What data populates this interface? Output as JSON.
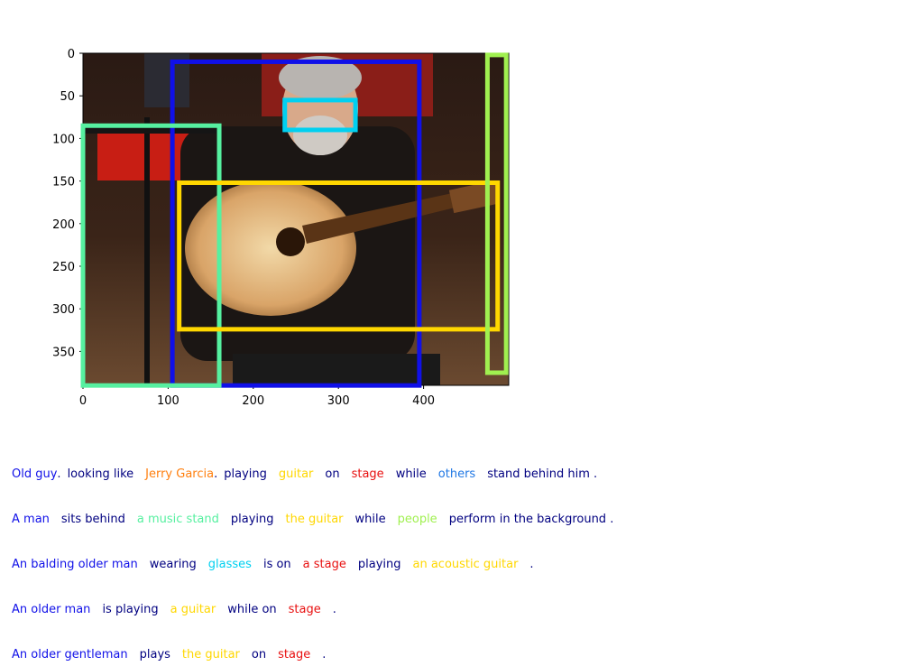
{
  "colors": {
    "blue": "#1010e8",
    "navy": "#000080",
    "orange": "#ff7f0e",
    "yellow": "#ffd700",
    "red": "#e81010",
    "azure": "#1f77e4",
    "mint": "#56f0a0",
    "lime": "#a0f050",
    "cyan": "#00d0f0"
  },
  "axes": {
    "x_ticks": [
      "0",
      "100",
      "200",
      "300",
      "400"
    ],
    "y_ticks": [
      "0",
      "50",
      "100",
      "150",
      "200",
      "250",
      "300",
      "350"
    ],
    "xlim": [
      0,
      500
    ],
    "ylim": [
      390,
      0
    ]
  },
  "boxes": [
    {
      "name": "man",
      "color": "#1010e8",
      "x": [
        105,
        395
      ],
      "y": [
        10,
        390
      ]
    },
    {
      "name": "music-stand",
      "color": "#56f0a0",
      "x": [
        0,
        160
      ],
      "y": [
        85,
        390
      ]
    },
    {
      "name": "guitar",
      "color": "#ffd700",
      "x": [
        113,
        487
      ],
      "y": [
        152,
        324
      ]
    },
    {
      "name": "glasses",
      "color": "#00d0f0",
      "x": [
        237,
        320
      ],
      "y": [
        55,
        90
      ]
    },
    {
      "name": "people",
      "color": "#a0f050",
      "x": [
        475,
        497
      ],
      "y": [
        2,
        375
      ]
    }
  ],
  "captions": [
    [
      {
        "text": "Old guy",
        "color": "#1010e8"
      },
      {
        "text": ".",
        "color": "#000080",
        "punct": true
      },
      {
        "text": "looking like",
        "color": "#000080"
      },
      {
        "text": "Jerry Garcia",
        "color": "#ff7f0e"
      },
      {
        "text": ".",
        "color": "#000080",
        "punct": true
      },
      {
        "text": "playing",
        "color": "#000080"
      },
      {
        "text": "guitar",
        "color": "#ffd700"
      },
      {
        "text": "on",
        "color": "#000080"
      },
      {
        "text": "stage",
        "color": "#e81010"
      },
      {
        "text": "while",
        "color": "#000080"
      },
      {
        "text": "others",
        "color": "#1f77e4"
      },
      {
        "text": "stand behind him .",
        "color": "#000080"
      }
    ],
    [
      {
        "text": "A man",
        "color": "#1010e8"
      },
      {
        "text": "sits behind",
        "color": "#000080"
      },
      {
        "text": "a music stand",
        "color": "#56f0a0"
      },
      {
        "text": "playing",
        "color": "#000080"
      },
      {
        "text": "the guitar",
        "color": "#ffd700"
      },
      {
        "text": "while",
        "color": "#000080"
      },
      {
        "text": "people",
        "color": "#a0f050"
      },
      {
        "text": "perform in the background .",
        "color": "#000080"
      }
    ],
    [
      {
        "text": "An balding older man",
        "color": "#1010e8"
      },
      {
        "text": "wearing",
        "color": "#000080"
      },
      {
        "text": "glasses",
        "color": "#00d0f0"
      },
      {
        "text": "is on",
        "color": "#000080"
      },
      {
        "text": "a stage",
        "color": "#e81010"
      },
      {
        "text": "playing",
        "color": "#000080"
      },
      {
        "text": "an acoustic guitar",
        "color": "#ffd700"
      },
      {
        "text": ".",
        "color": "#000080"
      }
    ],
    [
      {
        "text": "An older man",
        "color": "#1010e8"
      },
      {
        "text": "is playing",
        "color": "#000080"
      },
      {
        "text": "a guitar",
        "color": "#ffd700"
      },
      {
        "text": "while on",
        "color": "#000080"
      },
      {
        "text": "stage",
        "color": "#e81010"
      },
      {
        "text": ".",
        "color": "#000080"
      }
    ],
    [
      {
        "text": "An older gentleman",
        "color": "#1010e8"
      },
      {
        "text": "plays",
        "color": "#000080"
      },
      {
        "text": "the guitar",
        "color": "#ffd700"
      },
      {
        "text": "on",
        "color": "#000080"
      },
      {
        "text": "stage",
        "color": "#e81010"
      },
      {
        "text": ".",
        "color": "#000080"
      }
    ]
  ]
}
